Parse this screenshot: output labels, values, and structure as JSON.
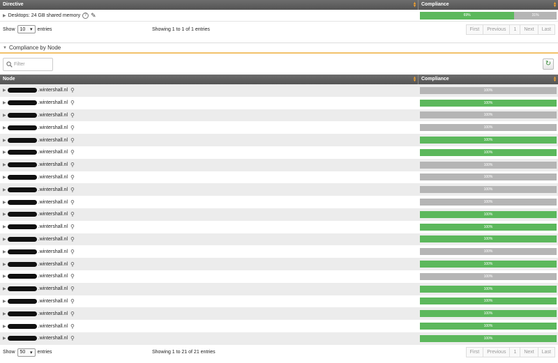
{
  "directive_table": {
    "headers": {
      "directive": "Directive",
      "compliance": "Compliance"
    },
    "rows": [
      {
        "name": "Desktops: 24 GB shared memory",
        "success_label": "69%",
        "repaired_label": "31%",
        "success_fraction": 0.69
      }
    ],
    "footer": {
      "show_label": "Show",
      "page_size": "10",
      "entries_label": "entries",
      "summary": "Showing 1 to 1 of 1 entries",
      "pager": [
        "First",
        "Previous",
        "1",
        "Next",
        "Last"
      ]
    }
  },
  "section": {
    "title": "Compliance by Node"
  },
  "filter": {
    "placeholder": "Filter"
  },
  "node_table": {
    "headers": {
      "node": "Node",
      "compliance": "Compliance"
    },
    "rows": [
      {
        "host": ".wintershall.nl",
        "value": "100%",
        "status": "grey"
      },
      {
        "host": ".wintershall.nl",
        "value": "100%",
        "status": "green"
      },
      {
        "host": ".wintershall.nl",
        "value": "100%",
        "status": "grey"
      },
      {
        "host": ".wintershall.nl",
        "value": "100%",
        "status": "grey"
      },
      {
        "host": ".wintershall.nl",
        "value": "100%",
        "status": "green"
      },
      {
        "host": ".wintershall.nl",
        "value": "100%",
        "status": "green"
      },
      {
        "host": ".wintershall.nl",
        "value": "100%",
        "status": "grey"
      },
      {
        "host": ".wintershall.nl",
        "value": "100%",
        "status": "grey"
      },
      {
        "host": ".wintershall.nl",
        "value": "100%",
        "status": "grey"
      },
      {
        "host": ".wintershall.nl",
        "value": "100%",
        "status": "grey"
      },
      {
        "host": ".wintershall.nl",
        "value": "100%",
        "status": "green"
      },
      {
        "host": ".wintershall.nl",
        "value": "100%",
        "status": "green"
      },
      {
        "host": ".wintershall.nl",
        "value": "100%",
        "status": "green"
      },
      {
        "host": ".wintershall.nl",
        "value": "100%",
        "status": "grey"
      },
      {
        "host": ".wintershall.nl",
        "value": "100%",
        "status": "green"
      },
      {
        "host": ".wintershall.nl",
        "value": "100%",
        "status": "grey"
      },
      {
        "host": ".wintershall.nl",
        "value": "100%",
        "status": "green"
      },
      {
        "host": ".wintershall.nl",
        "value": "100%",
        "status": "green"
      },
      {
        "host": ".wintershall.nl",
        "value": "100%",
        "status": "green"
      },
      {
        "host": ".wintershall.nl",
        "value": "100%",
        "status": "green"
      },
      {
        "host": ".wintershall.nl",
        "value": "100%",
        "status": "green"
      }
    ],
    "footer": {
      "show_label": "Show",
      "page_size": "50",
      "entries_label": "entries",
      "summary": "Showing 1 to 21 of 21 entries",
      "pager": [
        "First",
        "Previous",
        "1",
        "Next",
        "Last"
      ]
    }
  },
  "colors": {
    "success": "#5cb85c",
    "neutral": "#b5b5b5",
    "accent": "#f2c26b",
    "header_bg": "#5f5f5f"
  },
  "icons": {
    "expand": "triangle-right-icon",
    "help": "question-circle-icon",
    "edit": "pencil-icon",
    "details": "magnifier-icon",
    "search": "search-icon",
    "refresh": "refresh-icon"
  }
}
